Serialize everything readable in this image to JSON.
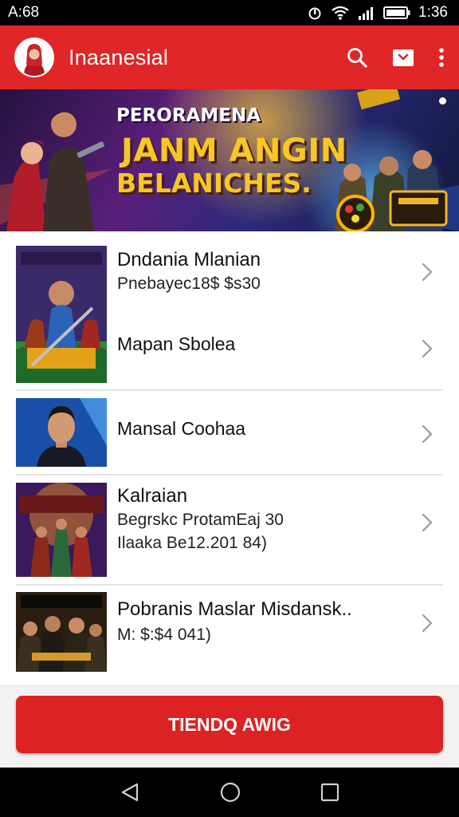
{
  "status_bar": {
    "time_left": "A:68",
    "time_right": "1:36"
  },
  "app_bar": {
    "title": "Inaanesial"
  },
  "banner": {
    "line1": "PERORAMENA",
    "line2": "JANM ANGIN",
    "line3": "BELANICHES."
  },
  "list": [
    {
      "title": "Dndania Mlanian",
      "subtitle": "Pnebayec18$ $s30",
      "extra": "Mapan Sbolea",
      "thumb_text": "DNDANIAN"
    },
    {
      "title": "Mansal Coohaa"
    },
    {
      "title": "Kalraian",
      "subtitle": "Begrskc ProtamEaj 30",
      "extra": "Ilaaka Be12.201 84)",
      "thumb_text": "DUNDANASK"
    },
    {
      "title": "Pobranis Maslar Misdansk..",
      "subtitle": "M: $:$4 041)",
      "thumb_text": "NANIAABE"
    }
  ],
  "cta": {
    "label": "TIENDQ AWIG"
  },
  "colors": {
    "brand_red": "#e02626",
    "banner_yellow": "#f7c724"
  },
  "icons": {
    "app_bar": [
      "search-icon",
      "cast-icon",
      "more-vert-icon"
    ],
    "nav": [
      "back-icon",
      "home-icon",
      "recents-icon"
    ]
  }
}
